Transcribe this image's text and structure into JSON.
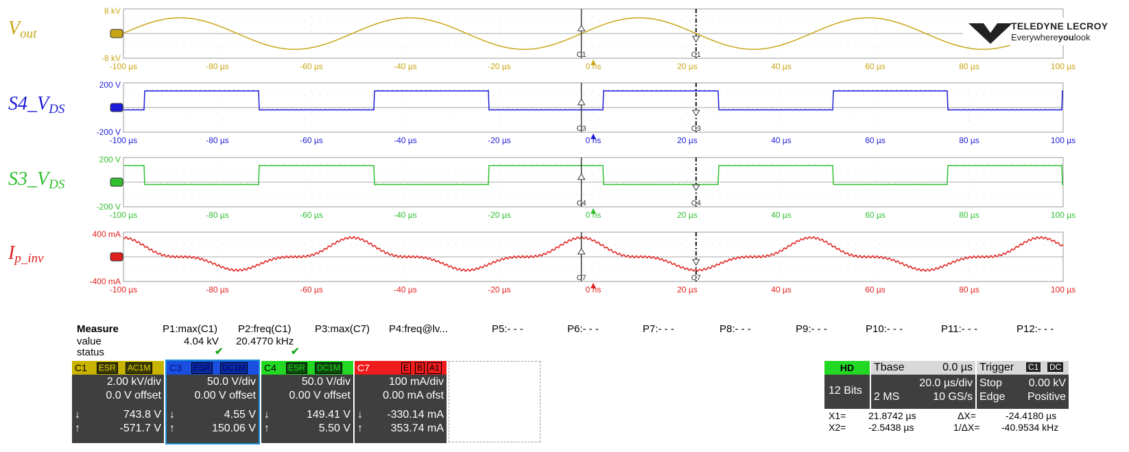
{
  "brand": {
    "name": "TELEDYNE LECROY",
    "tagline_pre": "Everywhere",
    "tagline_bold": "you",
    "tagline_post": "look"
  },
  "traces": [
    {
      "id": "C1",
      "label": "V",
      "sub": "out",
      "color": "#c8a514",
      "top_scale": "8 kV",
      "bottom_scale": "-8 kV",
      "cursor_tag": "C1"
    },
    {
      "id": "C3",
      "label": "S4_V",
      "sub": "DS",
      "color": "#1c1cd8",
      "top_scale": "200 V",
      "bottom_scale": "-200 V",
      "cursor_tag": "C3"
    },
    {
      "id": "C4",
      "label": "S3_V",
      "sub": "DS",
      "color": "#2fbf2f",
      "top_scale": "200 V",
      "bottom_scale": "-200 V",
      "cursor_tag": "C4"
    },
    {
      "id": "C7",
      "label": "I",
      "sub": "p_inv",
      "color": "#e0201c",
      "top_scale": "400 mA",
      "bottom_scale": "-400 mA",
      "cursor_tag": "C7"
    }
  ],
  "time_axis": [
    "-100 µs",
    "-80 µs",
    "-60 µs",
    "-40 µs",
    "-20 µs",
    "0 ns",
    "20 µs",
    "40 µs",
    "60 µs",
    "80 µs",
    "100 µs"
  ],
  "measure": {
    "title": "Measure",
    "row_labels": [
      "value",
      "status"
    ],
    "params": [
      "P1:max(C1)",
      "P2:freq(C1)",
      "P3:max(C7)",
      "P4:freq@lv...",
      "P5:- - -",
      "P6:- - -",
      "P7:- - -",
      "P8:- - -",
      "P9:- - -",
      "P10:- - -",
      "P11:- - -",
      "P12:- - -"
    ],
    "values": [
      "4.04 kV",
      "20.4770 kHz"
    ],
    "status": [
      "✔",
      "✔"
    ]
  },
  "channels": [
    {
      "name": "C1",
      "badges": [
        "ESR",
        "AC1M"
      ],
      "scale": "2.00 kV/div",
      "offset": "0.0 V offset",
      "down": "743.8 V",
      "up": "-571.7 V",
      "color": "#c8b400"
    },
    {
      "name": "C3",
      "badges": [
        "ESR",
        "DC1M"
      ],
      "scale": "50.0 V/div",
      "offset": "0.00 V offset",
      "down": "4.55 V",
      "up": "150.06 V",
      "color": "#1a4fe0"
    },
    {
      "name": "C4",
      "badges": [
        "ESR",
        "DC1M"
      ],
      "scale": "50.0 V/div",
      "offset": "0.00 V offset",
      "down": "149.41 V",
      "up": "5.50 V",
      "color": "#22d822"
    },
    {
      "name": "C7",
      "badges": [
        "E",
        "B",
        "A1"
      ],
      "scale": "100 mA/div",
      "offset": "0.00 mA ofst",
      "down": "-330.14 mA",
      "up": "353.74 mA",
      "color": "#ee1c1c"
    }
  ],
  "timebase": {
    "hd": "HD",
    "bits": "12 Bits",
    "title": "Tbase",
    "delay": "0.0 µs",
    "per_div": "20.0 µs/div",
    "samples": "2 MS",
    "rate": "10 GS/s"
  },
  "trigger": {
    "title": "Trigger",
    "src": "C1",
    "coupling": "DC",
    "mode": "Stop",
    "level": "0.00 kV",
    "type": "Edge",
    "slope": "Positive"
  },
  "cursors": {
    "x1_label": "X1=",
    "x1": "21.8742 µs",
    "x2_label": "X2=",
    "x2": "-2.5438 µs",
    "dx_label": "ΔX=",
    "dx": "-24.4180 µs",
    "inv_label": "1/ΔX=",
    "inv": "-40.9534 kHz"
  }
}
